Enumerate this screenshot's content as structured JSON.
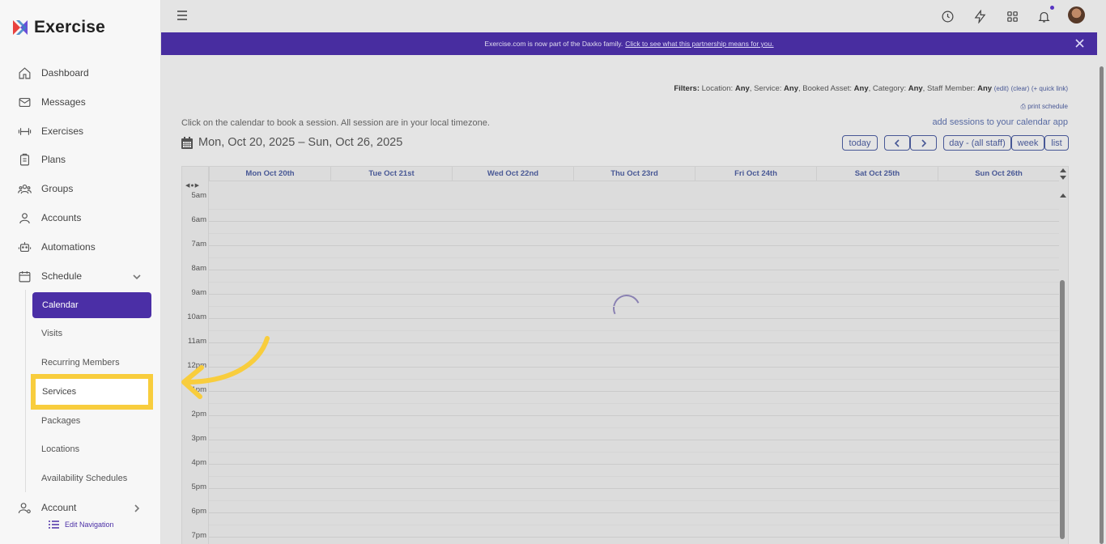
{
  "app": {
    "name": "Exercise"
  },
  "sidebar": {
    "items": [
      {
        "label": "Dashboard"
      },
      {
        "label": "Messages"
      },
      {
        "label": "Exercises"
      },
      {
        "label": "Plans"
      },
      {
        "label": "Groups"
      },
      {
        "label": "Accounts"
      },
      {
        "label": "Automations"
      },
      {
        "label": "Schedule"
      },
      {
        "label": "Account"
      }
    ],
    "schedule_sub": [
      {
        "label": "Calendar"
      },
      {
        "label": "Visits"
      },
      {
        "label": "Recurring Members"
      },
      {
        "label": "Services"
      },
      {
        "label": "Packages"
      },
      {
        "label": "Locations"
      },
      {
        "label": "Availability Schedules"
      }
    ],
    "edit_navigation": "Edit Navigation"
  },
  "banner": {
    "text": "Exercise.com is now part of the Daxko family.",
    "link": "Click to see what this partnership means for you."
  },
  "filters": {
    "label": "Filters:",
    "location_k": "Location:",
    "location_v": "Any",
    "service_k": "Service:",
    "service_v": "Any",
    "asset_k": "Booked Asset:",
    "asset_v": "Any",
    "category_k": "Category:",
    "category_v": "Any",
    "staff_k": "Staff Member:",
    "staff_v": "Any",
    "edit": "(edit)",
    "clear": "(clear)",
    "quick": "(+ quick link)",
    "print": "print schedule"
  },
  "calendar": {
    "instruction": "Click on the calendar to book a session. All session are in your local timezone.",
    "add_sessions": "add sessions to your calendar app",
    "date_range": "Mon, Oct 20, 2025 – Sun, Oct 26, 2025",
    "today": "today",
    "day_view": "day - (all staff)",
    "week_view": "week",
    "list_view": "list",
    "days": [
      "Mon Oct 20th",
      "Tue Oct 21st",
      "Wed Oct 22nd",
      "Thu Oct 23rd",
      "Fri Oct 24th",
      "Sat Oct 25th",
      "Sun Oct 26th"
    ],
    "hours": [
      "5am",
      "6am",
      "7am",
      "8am",
      "9am",
      "10am",
      "11am",
      "12pm",
      "1pm",
      "2pm",
      "3pm",
      "4pm",
      "5pm",
      "6pm",
      "7pm"
    ]
  },
  "colors": {
    "accent": "#4b2fa6",
    "highlight": "#f8cd3d",
    "link": "#4b5b9a"
  }
}
